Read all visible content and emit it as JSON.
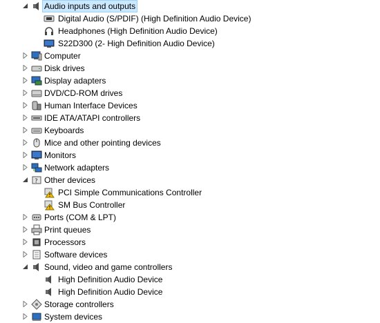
{
  "tree": {
    "categories": [
      {
        "label": "Audio inputs and outputs",
        "expanded": true,
        "selected": true,
        "icon": "speaker-icon",
        "children": [
          {
            "label": "Digital Audio (S/PDIF) (High Definition Audio Device)",
            "icon": "spdif-icon"
          },
          {
            "label": "Headphones (High Definition Audio Device)",
            "icon": "headphones-icon"
          },
          {
            "label": "S22D300 (2- High Definition Audio Device)",
            "icon": "monitor-audio-icon"
          }
        ]
      },
      {
        "label": "Computer",
        "expanded": false,
        "icon": "computer-icon"
      },
      {
        "label": "Disk drives",
        "expanded": false,
        "icon": "disk-drive-icon"
      },
      {
        "label": "Display adapters",
        "expanded": false,
        "icon": "display-adapter-icon"
      },
      {
        "label": "DVD/CD-ROM drives",
        "expanded": false,
        "icon": "dvd-drive-icon"
      },
      {
        "label": "Human Interface Devices",
        "expanded": false,
        "icon": "hid-icon"
      },
      {
        "label": "IDE ATA/ATAPI controllers",
        "expanded": false,
        "icon": "ide-controller-icon"
      },
      {
        "label": "Keyboards",
        "expanded": false,
        "icon": "keyboard-icon"
      },
      {
        "label": "Mice and other pointing devices",
        "expanded": false,
        "icon": "mouse-icon"
      },
      {
        "label": "Monitors",
        "expanded": false,
        "icon": "monitor-icon"
      },
      {
        "label": "Network adapters",
        "expanded": false,
        "icon": "network-adapter-icon"
      },
      {
        "label": "Other devices",
        "expanded": true,
        "icon": "other-devices-icon",
        "children": [
          {
            "label": "PCI Simple Communications Controller",
            "icon": "warning-device-icon"
          },
          {
            "label": "SM Bus Controller",
            "icon": "warning-device-icon"
          }
        ]
      },
      {
        "label": "Ports (COM & LPT)",
        "expanded": false,
        "icon": "port-icon"
      },
      {
        "label": "Print queues",
        "expanded": false,
        "icon": "printer-icon"
      },
      {
        "label": "Processors",
        "expanded": false,
        "icon": "processor-icon"
      },
      {
        "label": "Software devices",
        "expanded": false,
        "icon": "software-device-icon"
      },
      {
        "label": "Sound, video and game controllers",
        "expanded": true,
        "icon": "speaker-icon",
        "children": [
          {
            "label": "High Definition Audio Device",
            "icon": "speaker-icon"
          },
          {
            "label": "High Definition Audio Device",
            "icon": "speaker-icon"
          }
        ]
      },
      {
        "label": "Storage controllers",
        "expanded": false,
        "icon": "storage-controller-icon"
      },
      {
        "label": "System devices",
        "expanded": false,
        "icon": "system-device-icon"
      }
    ]
  },
  "colors": {
    "selection": "#cce8ff",
    "selection_border": "#99d1ff",
    "warning": "#f5c000"
  }
}
